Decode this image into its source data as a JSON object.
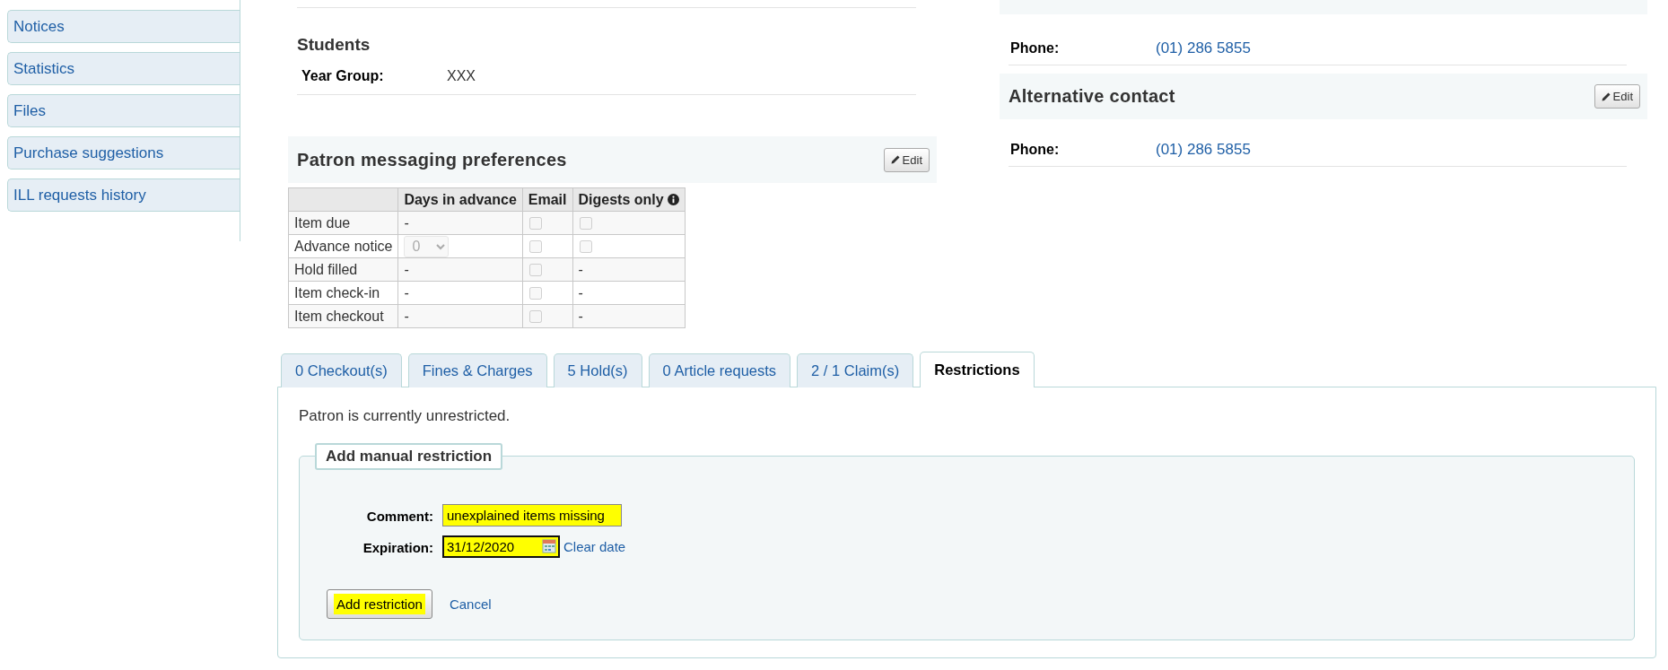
{
  "sidebar": {
    "items": [
      {
        "label": "Notices",
        "selected": false
      },
      {
        "label": "Statistics",
        "selected": false
      },
      {
        "label": "Files",
        "selected": false
      },
      {
        "label": "Purchase suggestions",
        "selected": false
      },
      {
        "label": "ILL requests history",
        "selected": false
      }
    ]
  },
  "students": {
    "title": "Students",
    "fields": [
      {
        "label": "Year Group:",
        "value": "XXX"
      }
    ]
  },
  "messaging": {
    "title": "Patron messaging preferences",
    "edit_button": "Edit",
    "columns": [
      {
        "label": "Days in advance",
        "info": false
      },
      {
        "label": "Email",
        "info": false
      },
      {
        "label": "Digests only",
        "info": true
      }
    ],
    "rows": [
      {
        "label": "Item due",
        "cells": [
          {
            "kind": "text",
            "text": "-"
          },
          {
            "kind": "checkbox",
            "checked": false,
            "disabled": true
          },
          {
            "kind": "checkbox",
            "checked": false,
            "disabled": true
          }
        ]
      },
      {
        "label": "Advance notice",
        "cells": [
          {
            "kind": "select",
            "value": "0",
            "disabled": true
          },
          {
            "kind": "checkbox",
            "checked": false,
            "disabled": true
          },
          {
            "kind": "checkbox",
            "checked": false,
            "disabled": true
          }
        ]
      },
      {
        "label": "Hold filled",
        "cells": [
          {
            "kind": "text",
            "text": "-"
          },
          {
            "kind": "checkbox",
            "checked": false,
            "disabled": true
          },
          {
            "kind": "text",
            "text": "-"
          }
        ]
      },
      {
        "label": "Item check-in",
        "cells": [
          {
            "kind": "text",
            "text": "-"
          },
          {
            "kind": "checkbox",
            "checked": false,
            "disabled": true
          },
          {
            "kind": "text",
            "text": "-"
          }
        ]
      },
      {
        "label": "Item checkout",
        "cells": [
          {
            "kind": "text",
            "text": "-"
          },
          {
            "kind": "checkbox",
            "checked": false,
            "disabled": true
          },
          {
            "kind": "text",
            "text": "-"
          }
        ]
      }
    ]
  },
  "contact": {
    "fields": [
      {
        "label": "Phone:",
        "value": "(01) 286 5855"
      }
    ]
  },
  "alternative_contact": {
    "title": "Alternative contact",
    "edit_button": "Edit",
    "fields": [
      {
        "label": "Phone:",
        "value": "(01) 286 5855"
      }
    ]
  },
  "tabs": [
    {
      "label": "0 Checkout(s)",
      "selected": false
    },
    {
      "label": "Fines & Charges",
      "selected": false
    },
    {
      "label": "5 Hold(s)",
      "selected": false
    },
    {
      "label": "0 Article requests",
      "selected": false
    },
    {
      "label": "2 / 1 Claim(s)",
      "selected": false
    },
    {
      "label": "Restrictions",
      "selected": true
    }
  ],
  "restrictions": {
    "message": "Patron is currently unrestricted.",
    "legend": "Add manual restriction",
    "comment": {
      "label": "Comment:",
      "value": "unexplained items missing",
      "highlighted": true
    },
    "expiration": {
      "label": "Expiration:",
      "value": "31/12/2020",
      "highlighted": true,
      "clear_link": "Clear date"
    },
    "submit_button": {
      "label": "Add restriction",
      "highlighted": true
    },
    "cancel_link": "Cancel"
  }
}
